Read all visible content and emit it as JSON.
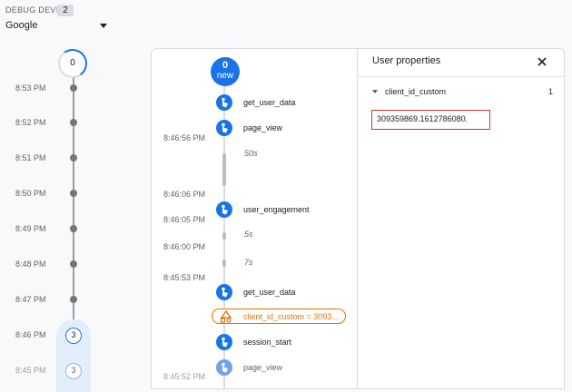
{
  "header": {
    "debug_label": "DEBUG DEVICE",
    "debug_count": "2",
    "device": "Google"
  },
  "minutes": {
    "top_count": "0",
    "rows": [
      {
        "time": "8:53 PM"
      },
      {
        "time": "8:52 PM"
      },
      {
        "time": "8:51 PM"
      },
      {
        "time": "8:50 PM"
      },
      {
        "time": "8:49 PM"
      },
      {
        "time": "8:48 PM"
      },
      {
        "time": "8:47 PM"
      },
      {
        "time": "8:46 PM",
        "count": "3"
      },
      {
        "time": "8:45 PM",
        "count": "3"
      }
    ]
  },
  "seconds": {
    "new_count": "0",
    "new_label": "new",
    "events": {
      "e1": "get_user_data",
      "e2": "page_view",
      "e3": "user_engagement",
      "e4": "get_user_data",
      "e5": "session_start",
      "e6": "page_view"
    },
    "times": {
      "t1": "8:46:56 PM",
      "t2": "8:46:06 PM",
      "t3": "8:46:05 PM",
      "t4": "8:46:00 PM",
      "t5": "8:45:53 PM",
      "t6": "8:45:52 PM"
    },
    "gaps": {
      "g1": "50s",
      "g2": "5s",
      "g3": "7s"
    },
    "user_property_pill": "client_id_custom = 3093..."
  },
  "user_properties": {
    "title": "User properties",
    "property_name": "client_id_custom",
    "property_count": "1",
    "property_value": "309359869.1612786080."
  },
  "colors": {
    "accent": "#1a73e8",
    "highlight_border": "#d93025",
    "user_property": "#e37400"
  }
}
